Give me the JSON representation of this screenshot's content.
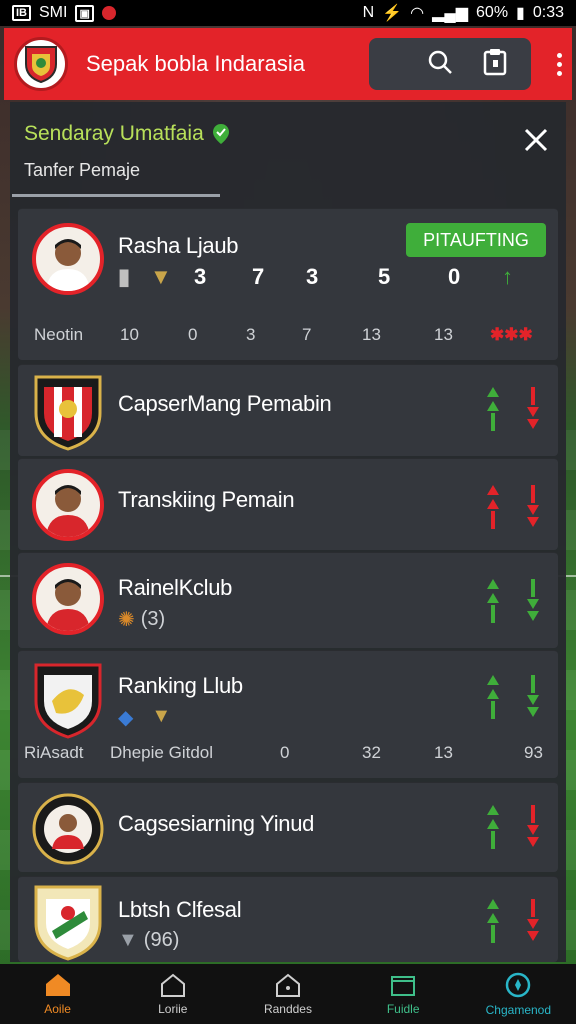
{
  "status_bar": {
    "carrier": "SMI",
    "battery": "60%",
    "time": "0:33"
  },
  "header": {
    "title": "Sepak bobla Indarasia"
  },
  "panel": {
    "title": "Sendaray Umatfaia",
    "subtitle": "Tanfer Pemaje"
  },
  "top_card": {
    "name": "Rasha Ljaub",
    "badge": "PITAUFTING",
    "stats": [
      "3",
      "7",
      "3",
      "5",
      "0"
    ],
    "numbers_label": "Neotin",
    "numbers": [
      "10",
      "0",
      "3",
      "7",
      "13",
      "13"
    ]
  },
  "list": [
    {
      "name": "CapserMang Pemabin",
      "up_color": "#3fae3a",
      "down_color": "#e32329"
    },
    {
      "name": "Transkiing Pemain",
      "up_color": "#e32329",
      "down_color": "#e32329"
    },
    {
      "name": "RainelKclub",
      "sub": "(3)",
      "up_color": "#3fae3a",
      "down_color": "#3fae3a"
    },
    {
      "name": "Ranking Llub",
      "up_color": "#3fae3a",
      "down_color": "#3fae3a",
      "foot_label": "RiAsadt",
      "foot_sub": "Dhepie Gitdol",
      "foot_values": [
        "0",
        "32",
        "13",
        "93"
      ]
    },
    {
      "name": "Cagsesiarning Yinud",
      "up_color": "#3fae3a",
      "down_color": "#e32329"
    },
    {
      "name": "Lbtsh Clfesal",
      "sub": "(96)",
      "up_color": "#3fae3a",
      "down_color": "#e32329"
    }
  ],
  "bottom_nav": [
    {
      "label": "Aoile",
      "icon": "home-icon",
      "color": "#f08a24"
    },
    {
      "label": "Loriie",
      "icon": "house-outline-icon",
      "color": "#cfcfcf"
    },
    {
      "label": "Randdes",
      "icon": "home-badge-icon",
      "color": "#cfcfcf"
    },
    {
      "label": "Fuidle",
      "icon": "folder-icon",
      "color": "#3fbf8a"
    },
    {
      "label": "Chgamenod",
      "icon": "compass-icon",
      "color": "#29b6c8"
    }
  ]
}
